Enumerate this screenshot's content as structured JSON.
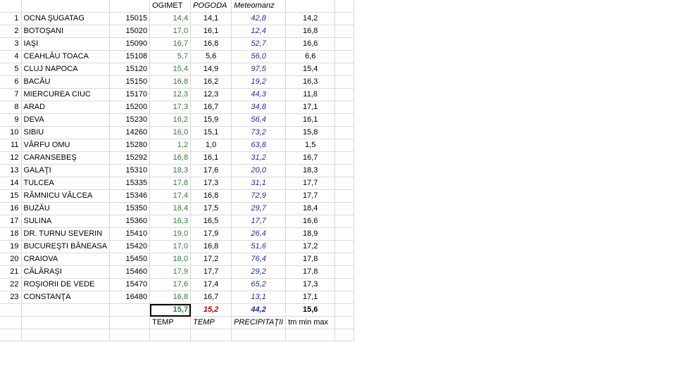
{
  "headers": {
    "ogimet": "OGIMET",
    "pogoda": "POGODA",
    "meteomanz": "Meteomanz"
  },
  "rows": [
    {
      "n": "1",
      "city": "OCNA ŞUGATAG",
      "code": "15015",
      "ogimet": "14,4",
      "pogoda": "14,1",
      "meteomanz": "42,8",
      "tm": "14,2"
    },
    {
      "n": "2",
      "city": "BOTOŞANI",
      "code": "15020",
      "ogimet": "17,0",
      "pogoda": "16,1",
      "meteomanz": "12,4",
      "tm": "16,8"
    },
    {
      "n": "3",
      "city": "IAŞI",
      "code": "15090",
      "ogimet": "16,7",
      "pogoda": "16,8",
      "meteomanz": "52,7",
      "tm": "16,6"
    },
    {
      "n": "4",
      "city": "CEAHLĂU TOACA",
      "code": "15108",
      "ogimet": "5,7",
      "pogoda": "5,6",
      "meteomanz": "56,0",
      "tm": "6,6"
    },
    {
      "n": "5",
      "city": "CLUJ NAPOCA",
      "code": "15120",
      "ogimet": "15,4",
      "pogoda": "14,9",
      "meteomanz": "97,5",
      "tm": "15,4"
    },
    {
      "n": "6",
      "city": "BACĂU",
      "code": "15150",
      "ogimet": "16,8",
      "pogoda": "16,2",
      "meteomanz": "19,2",
      "tm": "16,3"
    },
    {
      "n": "7",
      "city": "MIERCUREA CIUC",
      "code": "15170",
      "ogimet": "12,3",
      "pogoda": "12,3",
      "meteomanz": "44,3",
      "tm": "11,8"
    },
    {
      "n": "8",
      "city": "ARAD",
      "code": "15200",
      "ogimet": "17,3",
      "pogoda": "16,7",
      "meteomanz": "34,8",
      "tm": "17,1"
    },
    {
      "n": "9",
      "city": "DEVA",
      "code": "15230",
      "ogimet": "16,2",
      "pogoda": "15,9",
      "meteomanz": "56,4",
      "tm": "16,1"
    },
    {
      "n": "10",
      "city": "SIBIU",
      "code": "14260",
      "ogimet": "16,0",
      "pogoda": "15,1",
      "meteomanz": "73,2",
      "tm": "15,8"
    },
    {
      "n": "11",
      "city": "VÂRFU OMU",
      "code": "15280",
      "ogimet": "1,2",
      "pogoda": "1,0",
      "meteomanz": "63,8",
      "tm": "1,5"
    },
    {
      "n": "12",
      "city": "CARANSEBEŞ",
      "code": "15292",
      "ogimet": "16,8",
      "pogoda": "16,1",
      "meteomanz": "31,2",
      "tm": "16,7"
    },
    {
      "n": "13",
      "city": "GALAŢI",
      "code": "15310",
      "ogimet": "18,3",
      "pogoda": "17,6",
      "meteomanz": "20,0",
      "tm": "18,3"
    },
    {
      "n": "14",
      "city": "TULCEA",
      "code": "15335",
      "ogimet": "17,8",
      "pogoda": "17,3",
      "meteomanz": "31,1",
      "tm": "17,7"
    },
    {
      "n": "15",
      "city": "RÂMNICU VÂLCEA",
      "code": "15346",
      "ogimet": "17,4",
      "pogoda": "16,8",
      "meteomanz": "72,9",
      "tm": "17,7"
    },
    {
      "n": "16",
      "city": "BUZĂU",
      "code": "15350",
      "ogimet": "18,4",
      "pogoda": "17,5",
      "meteomanz": "29,7",
      "tm": "18,4"
    },
    {
      "n": "17",
      "city": "SULINA",
      "code": "15360",
      "ogimet": "16,3",
      "pogoda": "16,5",
      "meteomanz": "17,7",
      "tm": "16,6"
    },
    {
      "n": "18",
      "city": "DR. TURNU SEVERIN",
      "code": "15410",
      "ogimet": "19,0",
      "pogoda": "17,9",
      "meteomanz": "26,4",
      "tm": "18,9"
    },
    {
      "n": "19",
      "city": "BUCUREŞTI BĂNEASA",
      "code": "15420",
      "ogimet": "17,0",
      "pogoda": "16,8",
      "meteomanz": "51,6",
      "tm": "17,2"
    },
    {
      "n": "20",
      "city": "CRAIOVA",
      "code": "15450",
      "ogimet": "18,0",
      "pogoda": "17,2",
      "meteomanz": "76,4",
      "tm": "17,8"
    },
    {
      "n": "21",
      "city": "CĂLĂRAŞI",
      "code": "15460",
      "ogimet": "17,9",
      "pogoda": "17,7",
      "meteomanz": "29,2",
      "tm": "17,8"
    },
    {
      "n": "22",
      "city": "ROŞIORII DE VEDE",
      "code": "15470",
      "ogimet": "17,6",
      "pogoda": "17,4",
      "meteomanz": "65,2",
      "tm": "17,3"
    },
    {
      "n": "23",
      "city": "CONSTANŢA",
      "code": "16480",
      "ogimet": "16,8",
      "pogoda": "16,7",
      "meteomanz": "13,1",
      "tm": "17,1"
    }
  ],
  "totals": {
    "ogimet": "15,7",
    "pogoda": "15,2",
    "meteomanz": "44,2",
    "tm": "15,6"
  },
  "footer": {
    "ogimet": "TEMP",
    "pogoda": "TEMP",
    "meteomanz": "PRECIPITAŢII",
    "tm": "tm min max"
  }
}
